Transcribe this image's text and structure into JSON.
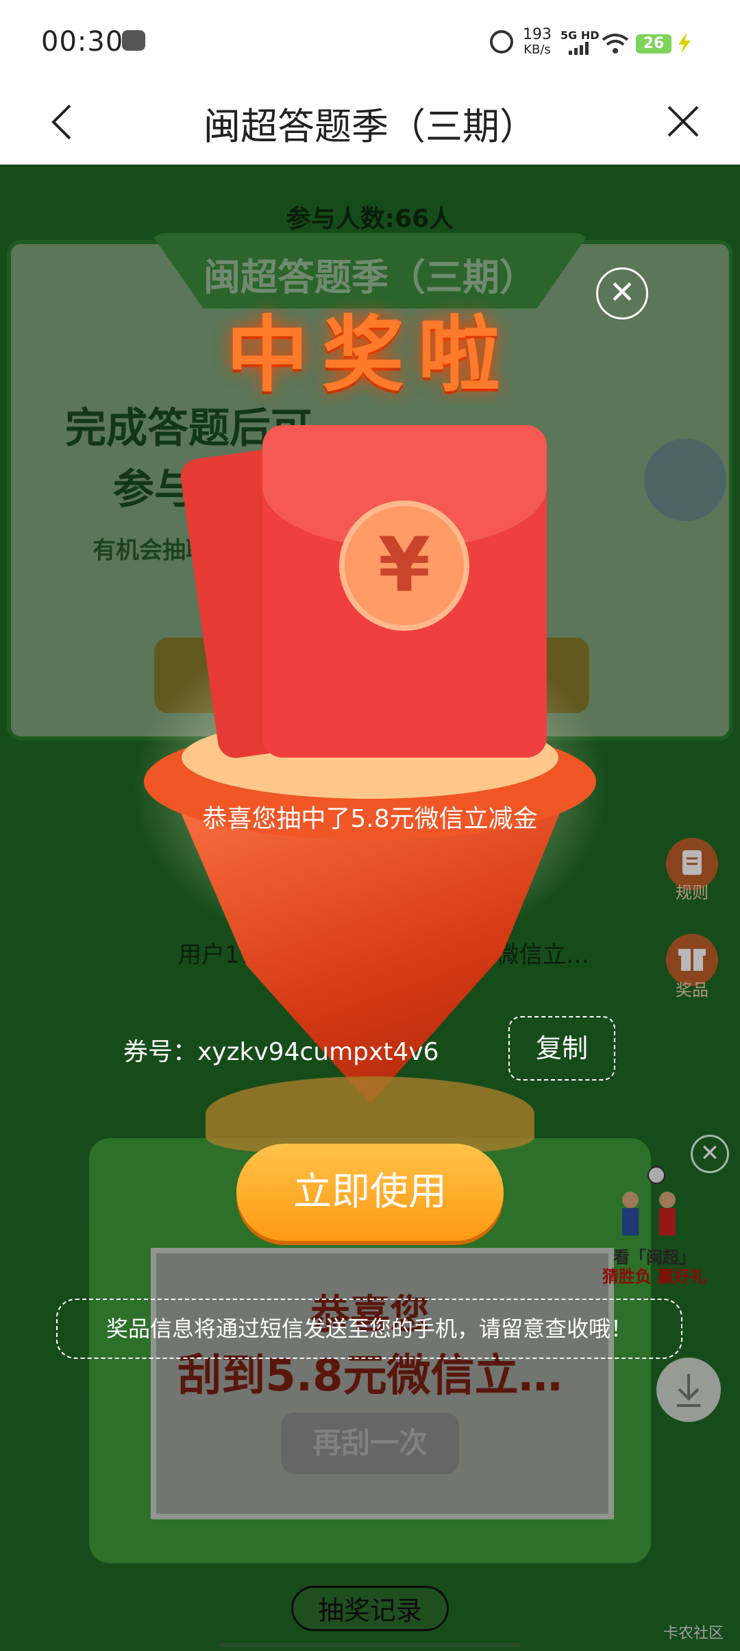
{
  "status_bar": {
    "time": "00:30",
    "speed_value": "193",
    "speed_unit": "KB/s",
    "network": "5G HD",
    "battery": "26"
  },
  "nav": {
    "title": "闽超答题季（三期）"
  },
  "page": {
    "participants": "参与人数:66人",
    "card_banner": "闽超答题季（三期）",
    "card_line1": "完成答题后可",
    "card_line2": "参与",
    "card_line3": "有机会抽取",
    "winner_line_left": "用户178",
    "winner_line_right": "元微信立…",
    "side_rules": "规则",
    "side_prizes": "奖品",
    "ad_text_line1": "看「闽超」",
    "ad_text_line2": "猜胜负 赢好礼",
    "scratch_title": "恭喜您",
    "scratch_prize": "刮到5.8元微信立…",
    "scratch_again": "再刮一次",
    "record_button": "抽奖记录",
    "watermark": "卡农社区"
  },
  "modal": {
    "heading": "中奖啦",
    "win_message": "恭喜您抽中了5.8元微信立减金",
    "coupon_label": "券号：xyzkv94cumpxt4v6",
    "copy_button": "复制",
    "use_button": "立即使用",
    "notice": "奖品信息将通过短信发送至您的手机，请留意查收哦！",
    "currency_symbol": "¥"
  },
  "colors": {
    "page_green": "#1f6a25",
    "red_envelope": "#ef3f3f",
    "orange_button": "#ff9a12"
  }
}
